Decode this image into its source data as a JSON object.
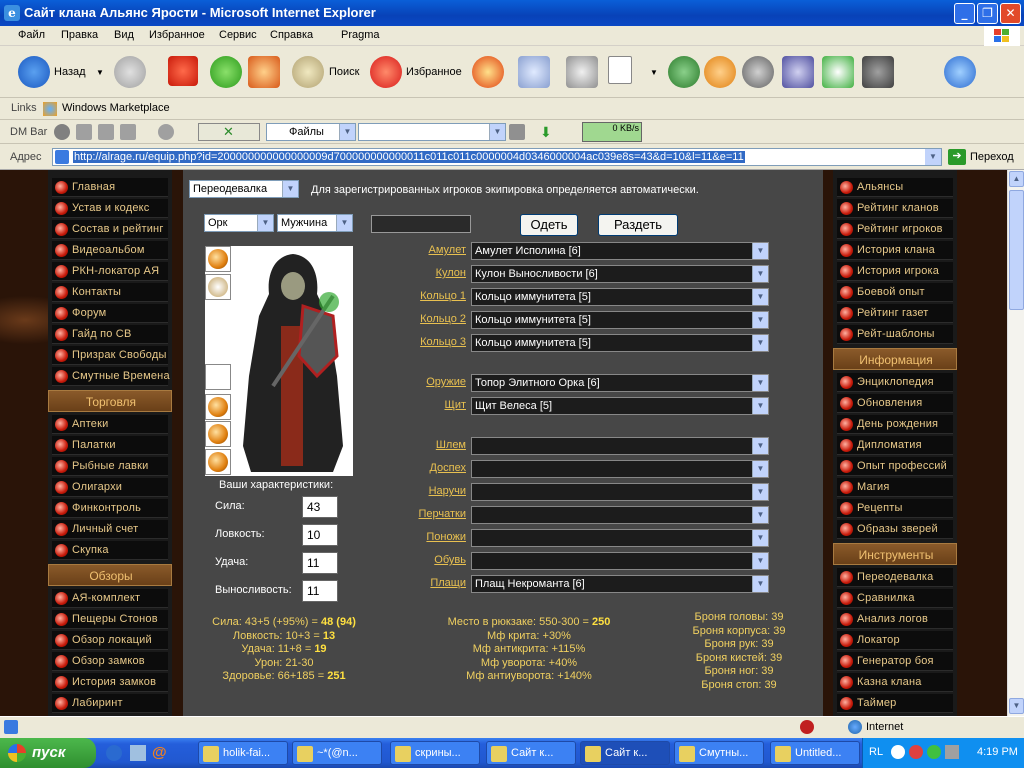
{
  "window": {
    "title": "Сайт клана Альянс Ярости - Microsoft Internet Explorer"
  },
  "menu": [
    "Файл",
    "Правка",
    "Вид",
    "Избранное",
    "Сервис",
    "Справка",
    "Pragma"
  ],
  "toolbar": {
    "back": "Назад",
    "search": "Поиск",
    "favorites": "Избранное"
  },
  "links": {
    "label": "Links",
    "item": "Windows Marketplace"
  },
  "dmbar": {
    "label": "DM Bar",
    "files": "Файлы",
    "speed": "0 KB/s"
  },
  "address": {
    "label": "Адрес",
    "url": "http://alrage.ru/equip.php?id=200000000000000009d700000000000011c011c011c0000004d0346000004ac039e8s=43&d=10&l=11&e=11",
    "go": "Переход"
  },
  "left_menu": {
    "group1": [
      "Главная",
      "Устав и кодекс",
      "Состав и рейтинг",
      "Видеоальбом",
      "РКН-локатор АЯ",
      "Контакты",
      "Форум",
      "Гайд по СВ",
      "Призрак Свободы",
      "Смутные Времена"
    ],
    "head_trade": "Торговля",
    "trade": [
      "Аптеки",
      "Палатки",
      "Рыбные лавки",
      "Олигархи",
      "Финконтроль",
      "Личный счет",
      "Скупка"
    ],
    "head_reviews": "Обзоры",
    "reviews": [
      "АЯ-комплект",
      "Пещеры Стонов",
      "Обзор локаций",
      "Обзор замков",
      "История замков",
      "Лабиринт"
    ]
  },
  "right_menu": {
    "group1": [
      "Альянсы",
      "Рейтинг кланов",
      "Рейтинг игроков",
      "История клана",
      "История игрока",
      "Боевой опыт",
      "Рейтинг газет",
      "Рейт-шаблоны"
    ],
    "head_info": "Информация",
    "info": [
      "Энциклопедия",
      "Обновления",
      "День рождения",
      "Дипломатия",
      "Опыт профессий",
      "Магия",
      "Рецепты",
      "Образы зверей"
    ],
    "head_tools": "Инструменты",
    "tools": [
      "Переодевалка",
      "Сравнилка",
      "Анализ логов",
      "Локатор",
      "Генератор боя",
      "Казна клана",
      "Таймер"
    ]
  },
  "equip": {
    "mode": "Переодевалка",
    "notice": "Для зарегистрированных игроков экипировка определяется автоматически.",
    "race": "Орк",
    "gender": "Мужчина",
    "name_value": "",
    "dress_btn": "Одеть",
    "undress_btn": "Раздеть",
    "slots": [
      {
        "label": "Амулет",
        "value": "Амулет Исполина [6]"
      },
      {
        "label": "Кулон",
        "value": "Кулон Выносливости [6]"
      },
      {
        "label": "Кольцо 1",
        "value": "Кольцо иммунитета [5]"
      },
      {
        "label": "Кольцо 2",
        "value": "Кольцо иммунитета [5]"
      },
      {
        "label": "Кольцо 3",
        "value": "Кольцо иммунитета [5]"
      }
    ],
    "weapons": [
      {
        "label": "Оружие",
        "value": "Топор Элитного Орка [6]"
      },
      {
        "label": "Щит",
        "value": "Щит Велеса [5]"
      }
    ],
    "armor": [
      {
        "label": "Шлем",
        "value": ""
      },
      {
        "label": "Доспех",
        "value": ""
      },
      {
        "label": "Наручи",
        "value": ""
      },
      {
        "label": "Перчатки",
        "value": ""
      },
      {
        "label": "Поножи",
        "value": ""
      },
      {
        "label": "Обувь",
        "value": ""
      },
      {
        "label": "Плащи",
        "value": "Плащ Некроманта [6]"
      }
    ],
    "stats_title": "Ваши характеристики:",
    "stats": [
      {
        "label": "Сила:",
        "value": "43"
      },
      {
        "label": "Ловкость:",
        "value": "10"
      },
      {
        "label": "Удача:",
        "value": "11"
      },
      {
        "label": "Выносливость:",
        "value": "11"
      }
    ],
    "summary_left": [
      {
        "text": "Сила: 43+5 (+95%) = ",
        "bold": "48 (94)"
      },
      {
        "text": "Ловкость: 10+3 = ",
        "bold": "13"
      },
      {
        "text": "Удача: 11+8 = ",
        "bold": "19"
      },
      {
        "text": "Урон: 21-30",
        "bold": ""
      },
      {
        "text": "Здоровье: 66+185 = ",
        "bold": "251"
      }
    ],
    "summary_mid": [
      {
        "text": "Место в рюкзаке: 550-300 = ",
        "bold": "250"
      },
      {
        "text": "Мф крита: +30%",
        "bold": ""
      },
      {
        "text": "Мф антикрита: +115%",
        "bold": ""
      },
      {
        "text": "Мф уворота: +40%",
        "bold": ""
      },
      {
        "text": "Мф антиуворота: +140%",
        "bold": ""
      }
    ],
    "summary_right": [
      "Броня головы: 39",
      "Броня корпуса: 39",
      "Броня рук: 39",
      "Броня кистей: 39",
      "Броня ног: 39",
      "Броня стоп: 39"
    ]
  },
  "statusbar": {
    "zone": "Internet"
  },
  "taskbar": {
    "start": "пуск",
    "tasks": [
      "holik-fai...",
      "~*(@n...",
      "скрины...",
      "Сайт к...",
      "Сайт к...",
      "Смутны...",
      "Untitled..."
    ],
    "lang": "RL",
    "clock": "4:19 PM"
  }
}
